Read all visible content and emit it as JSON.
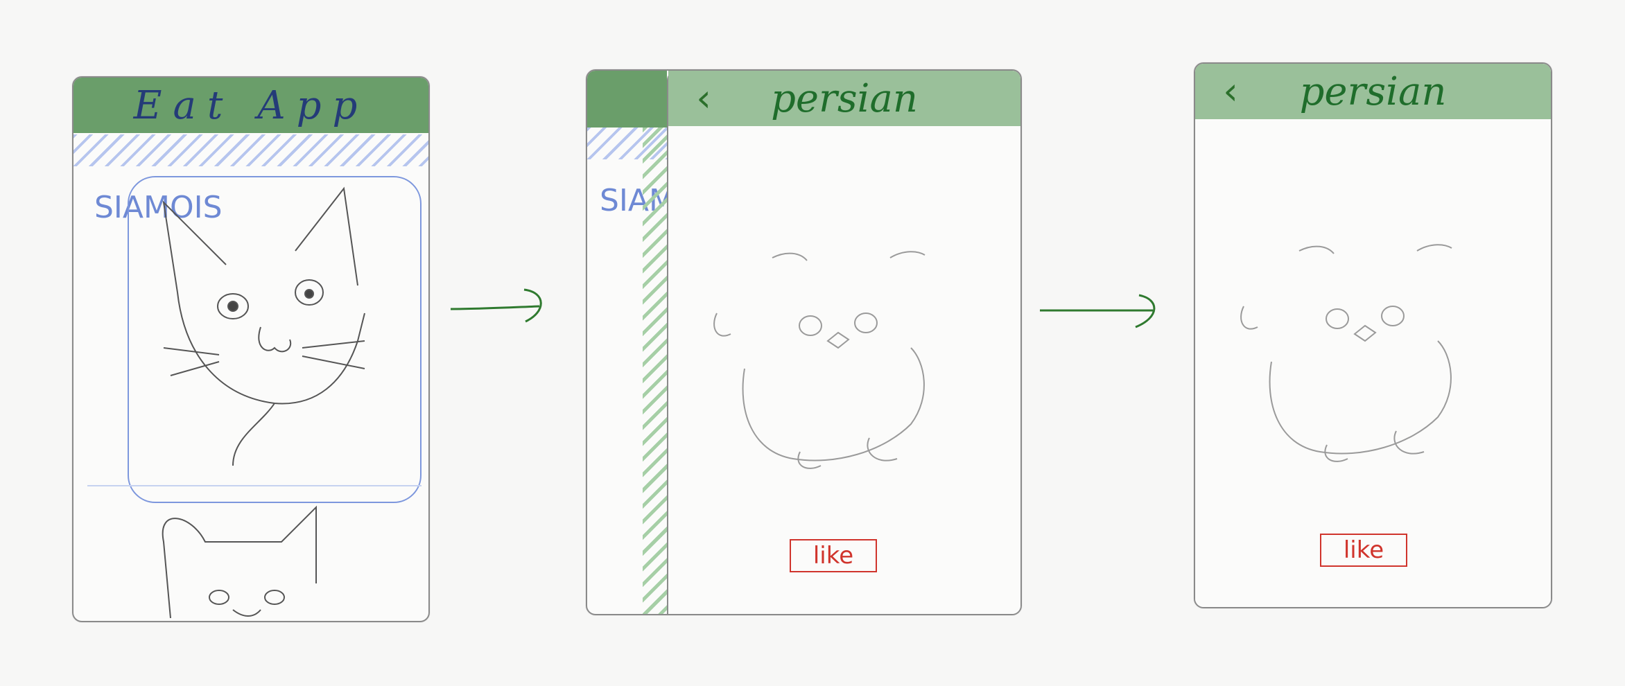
{
  "screens": {
    "list": {
      "app_title": "Eat App",
      "breed_label": "SIAMOIS"
    },
    "detail_transition": {
      "breed_label": "SIAMOIS",
      "title": "persian",
      "back_icon": "chevron-left-icon",
      "like_label": "like"
    },
    "detail": {
      "title": "persian",
      "back_icon": "chevron-left-icon",
      "like_label": "like"
    }
  },
  "colors": {
    "header_dark": "#6a9e6a",
    "header_light": "#9ac09a",
    "title_blue": "#243b78",
    "label_blue": "#6e89d4",
    "title_green": "#1f6d2b",
    "like_red": "#d0342c",
    "arrow_green": "#2f7a2f"
  }
}
